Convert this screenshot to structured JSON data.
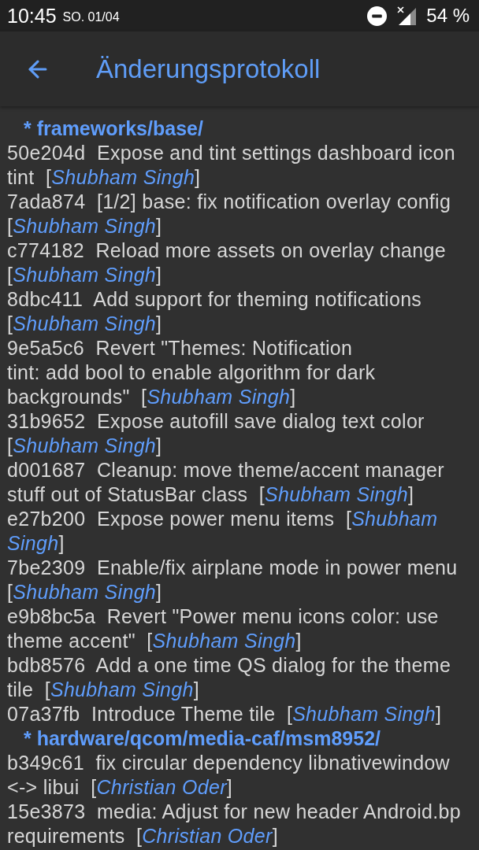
{
  "status_bar": {
    "time": "10:45",
    "date": "SO. 01/04",
    "battery": "54 %"
  },
  "app_bar": {
    "title": "Änderungsprotokoll"
  },
  "changelog": [
    {
      "path": "* frameworks/base/",
      "commits": [
        "50e204d  Expose and tint settings dashboard icon tint  [*Shubham Singh*]",
        "7ada874  [1/2] base: fix notification overlay config  [*Shubham Singh*]",
        "c774182  Reload more assets on overlay change  [*Shubham Singh*]",
        "8dbc411  Add support for theming notifications  [*Shubham Singh*]",
        "9e5a5c6  Revert \"Themes: Notification\ntint: add bool to enable algorithm for dark backgrounds\"  [*Shubham Singh*]",
        "31b9652  Expose autofill save dialog text color  [*Shubham Singh*]",
        "d001687  Cleanup: move theme/accent manager stuff out of StatusBar class  [*Shubham Singh*]",
        "e27b200  Expose power menu items  [*Shubham Singh*]",
        "7be2309  Enable/fix airplane mode in power menu  [*Shubham Singh*]",
        "e9b8bc5a  Revert \"Power menu icons color: use theme accent\"  [*Shubham Singh*]",
        "bdb8576  Add a one time QS dialog for the theme tile  [*Shubham Singh*]",
        "07a37fb  Introduce Theme tile  [*Shubham Singh*]"
      ]
    },
    {
      "path": "* hardware/qcom/media-caf/msm8952/",
      "commits": [
        "b349c61  fix circular dependency libnativewindow <-> libui  [*Christian Oder*]",
        "15e3873  media: Adjust for new header Android.bp requirements  [*Christian Oder*]"
      ]
    }
  ]
}
